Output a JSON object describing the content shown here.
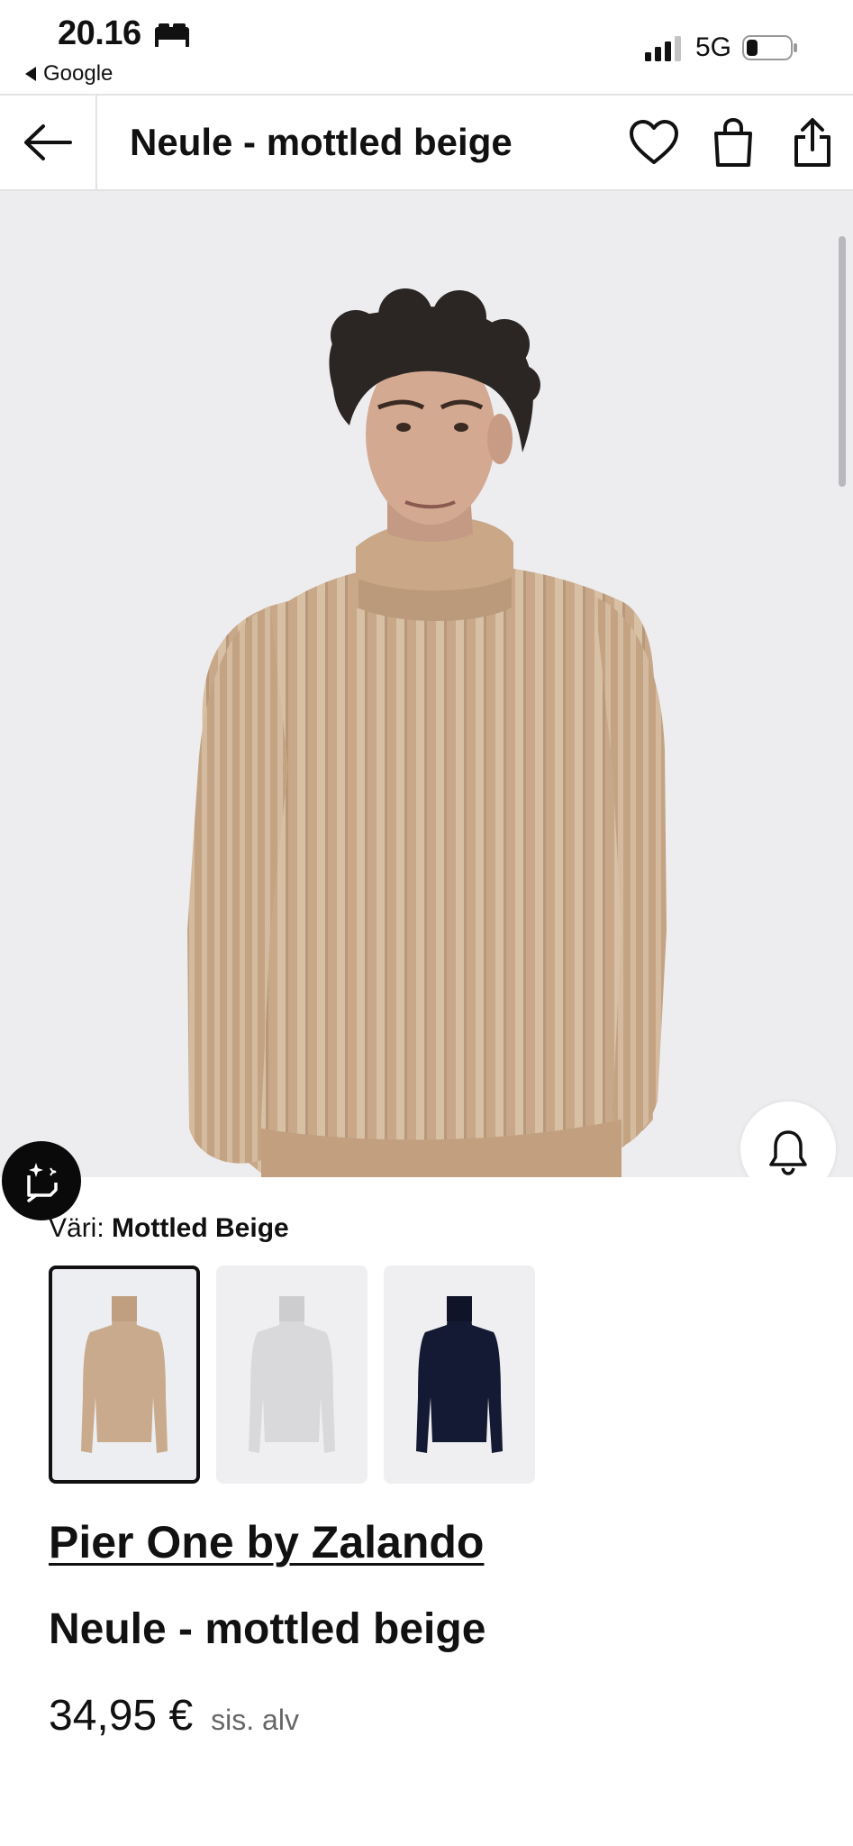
{
  "status_bar": {
    "time": "20.16",
    "back_app": "Google",
    "network": "5G"
  },
  "header": {
    "title": "Neule - mottled beige"
  },
  "product": {
    "color_label": "Väri:",
    "color_value": "Mottled Beige",
    "swatches": [
      {
        "name": "Mottled Beige",
        "color": "#c9aa8c",
        "selected": true
      },
      {
        "name": "Light Grey",
        "color": "#d9d9dc",
        "selected": false
      },
      {
        "name": "Navy",
        "color": "#141a33",
        "selected": false
      }
    ],
    "brand": "Pier One by Zalando",
    "name": "Neule - mottled beige",
    "price": "34,95 €",
    "vat_note": "sis. alv"
  },
  "colors": {
    "sweater": "#c8a888",
    "background": "#ededf0",
    "text": "#111111"
  },
  "icons": [
    "bed-icon",
    "signal-icon",
    "battery-icon",
    "back-arrow-icon",
    "heart-icon",
    "shopping-bag-icon",
    "share-icon",
    "bell-icon",
    "ai-sparkle-icon"
  ]
}
